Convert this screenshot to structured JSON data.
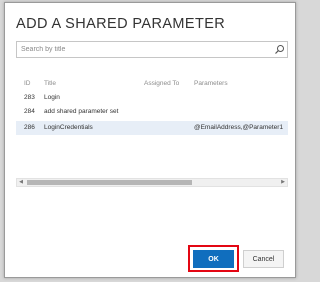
{
  "dialog": {
    "title": "ADD A SHARED PARAMETER"
  },
  "search": {
    "placeholder": "Search by title",
    "value": ""
  },
  "table": {
    "headers": {
      "id": "ID",
      "title": "Title",
      "assigned_to": "Assigned To",
      "parameters": "Parameters"
    },
    "rows": [
      {
        "id": "283",
        "title": "Login",
        "assigned_to": "",
        "parameters": "",
        "selected": false
      },
      {
        "id": "284",
        "title": "add shared parameter set",
        "assigned_to": "",
        "parameters": "",
        "selected": false
      },
      {
        "id": "286",
        "title": "LoginCredentials",
        "assigned_to": "",
        "parameters": "@EmailAddress,@Parameter1",
        "selected": true
      }
    ]
  },
  "buttons": {
    "ok": "OK",
    "cancel": "Cancel"
  },
  "colors": {
    "primary_button": "#106ebe",
    "highlight_outline": "#e30613",
    "selected_row": "#e7eef7"
  },
  "icons": {
    "search": "search-icon",
    "scroll_left": "chevron-left-icon",
    "scroll_right": "chevron-right-icon"
  }
}
